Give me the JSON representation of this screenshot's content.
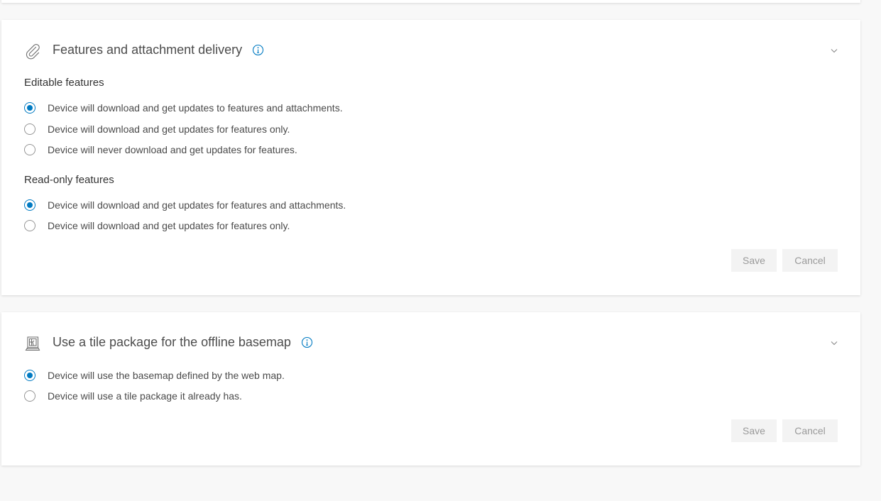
{
  "features_section": {
    "title": "Features and attachment delivery",
    "editable": {
      "label": "Editable features",
      "options": [
        {
          "label": "Device will download and get updates to features and attachments.",
          "checked": true
        },
        {
          "label": "Device will download and get updates for features only.",
          "checked": false
        },
        {
          "label": "Device will never download and get updates for features.",
          "checked": false
        }
      ]
    },
    "readonly": {
      "label": "Read-only features",
      "options": [
        {
          "label": "Device will download and get updates for features and attachments.",
          "checked": true
        },
        {
          "label": "Device will download and get updates for features only.",
          "checked": false
        }
      ]
    },
    "save_label": "Save",
    "cancel_label": "Cancel"
  },
  "tile_section": {
    "title": "Use a tile package for the offline basemap",
    "options": [
      {
        "label": "Device will use the basemap defined by the web map.",
        "checked": true
      },
      {
        "label": "Device will use a tile package it already has.",
        "checked": false
      }
    ],
    "save_label": "Save",
    "cancel_label": "Cancel"
  },
  "icons": {
    "features": "paperclip-icon",
    "tile": "map-book-icon",
    "info": "info-icon",
    "expand": "chevron-down-icon"
  },
  "colors": {
    "accent": "#007ac2",
    "background": "#f8f8f8",
    "card": "#ffffff",
    "button_bg": "#f3f3f3",
    "button_text": "#9a9a9a"
  }
}
